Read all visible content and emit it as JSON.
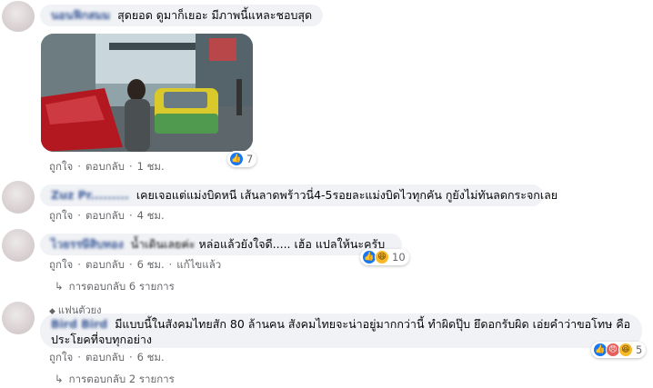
{
  "comments": [
    {
      "author": "นอนฟิกสมม",
      "text": "สุดยอด ดูมาก็เยอะ มีภาพนี้แหละชอบสุด",
      "actions": {
        "like": "ถูกใจ",
        "reply": "ตอบกลับ",
        "time": "1 ชม."
      },
      "reactions": {
        "count": "7"
      }
    },
    {
      "author": "Zuz Pr.........",
      "text": "เคยเจอแต่แม่งบิดหนี เส้นลาดพร้าวนี่4-5รอยละแม่งบิดไวทุกคัน กูยังไม่ทันลดกระจกเลย",
      "actions": {
        "like": "ถูกใจ",
        "reply": "ตอบกลับ",
        "time": "4 ชม."
      }
    },
    {
      "author": "ไวยรรษีสิบทอง",
      "text_blurred": "น้ำเดินเลยค่ะ",
      "text": "หล่อแล้วยังใจดี..... เฮ้อ แปลให้นะครับ",
      "actions": {
        "like": "ถูกใจ",
        "reply": "ตอบกลับ",
        "time": "6 ชม.",
        "edited": "แก้ไขแล้ว"
      },
      "reactions": {
        "count": "10"
      },
      "replies": "การตอบกลับ 6 รายการ"
    },
    {
      "badge": "แฟนตัวยง",
      "author": "Bird Bird",
      "text": "มีแบบนี้ในสังคมไทยสัก 80 ล้านคน สังคมไทยจะน่าอยู่มากกว่านี้ ทำผิดปุ๊บ ยึดอกรับผิด เอ่ยคำว่าขอโทษ คือประโยคที่จบทุกอย่าง",
      "actions": {
        "like": "ถูกใจ",
        "reply": "ตอบกลับ",
        "time": "6 ชม."
      },
      "reactions": {
        "count": "5"
      },
      "replies": "การตอบกลับ 2 รายการ"
    }
  ],
  "icons": {
    "like": "thumbs-up-icon",
    "haha": "haha-face-icon",
    "angry": "angry-face-icon",
    "reply_arrow": "reply-arrow-icon"
  },
  "colors": {
    "like": "#1877f2",
    "haha": "#f7b928",
    "angry": "#e4605a",
    "bubble": "#f0f2f5",
    "author": "#3b5998",
    "meta": "#65676b"
  }
}
